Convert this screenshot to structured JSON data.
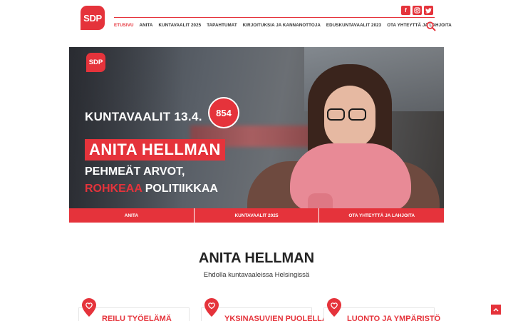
{
  "brand": {
    "logo_text": "SDP",
    "accent": "#e5333b"
  },
  "nav": {
    "items": [
      {
        "label": "ETUSIVU",
        "active": true
      },
      {
        "label": "ANITA"
      },
      {
        "label": "KUNTAVAALIT 2025"
      },
      {
        "label": "TAPAHTUMAT"
      },
      {
        "label": "KIRJOITUKSIA JA KANNANOTTOJA"
      },
      {
        "label": "EDUSKUNTAVAALIT 2023"
      },
      {
        "label": "OTA YHTEYTTÄ JA LAHJOITA"
      }
    ]
  },
  "socials": [
    "facebook-icon",
    "instagram-icon",
    "twitter-icon"
  ],
  "hero": {
    "logo_text": "SDP",
    "campaign": "KUNTAVAALIT 13.4.",
    "number": "854",
    "name": "ANITA HELLMAN",
    "slogan_line1": "PEHMEÄT ARVOT,",
    "slogan_highlight": "ROHKEAA",
    "slogan_rest": "POLITIIKKAA",
    "buttons": [
      "ANITA",
      "KUNTAVAALIT 2025",
      "OTA YHTEYTTÄ JA LAHJOITA"
    ]
  },
  "intro": {
    "title": "ANITA HELLMAN",
    "subtitle": "Ehdolla kuntavaaleissa Helsingissä"
  },
  "cards": [
    {
      "title": "REILU TYÖELÄMÄ"
    },
    {
      "title": "YKSINASUVIEN PUOLELLA"
    },
    {
      "title": "LUONTO JA YMPÄRISTÖ"
    }
  ]
}
